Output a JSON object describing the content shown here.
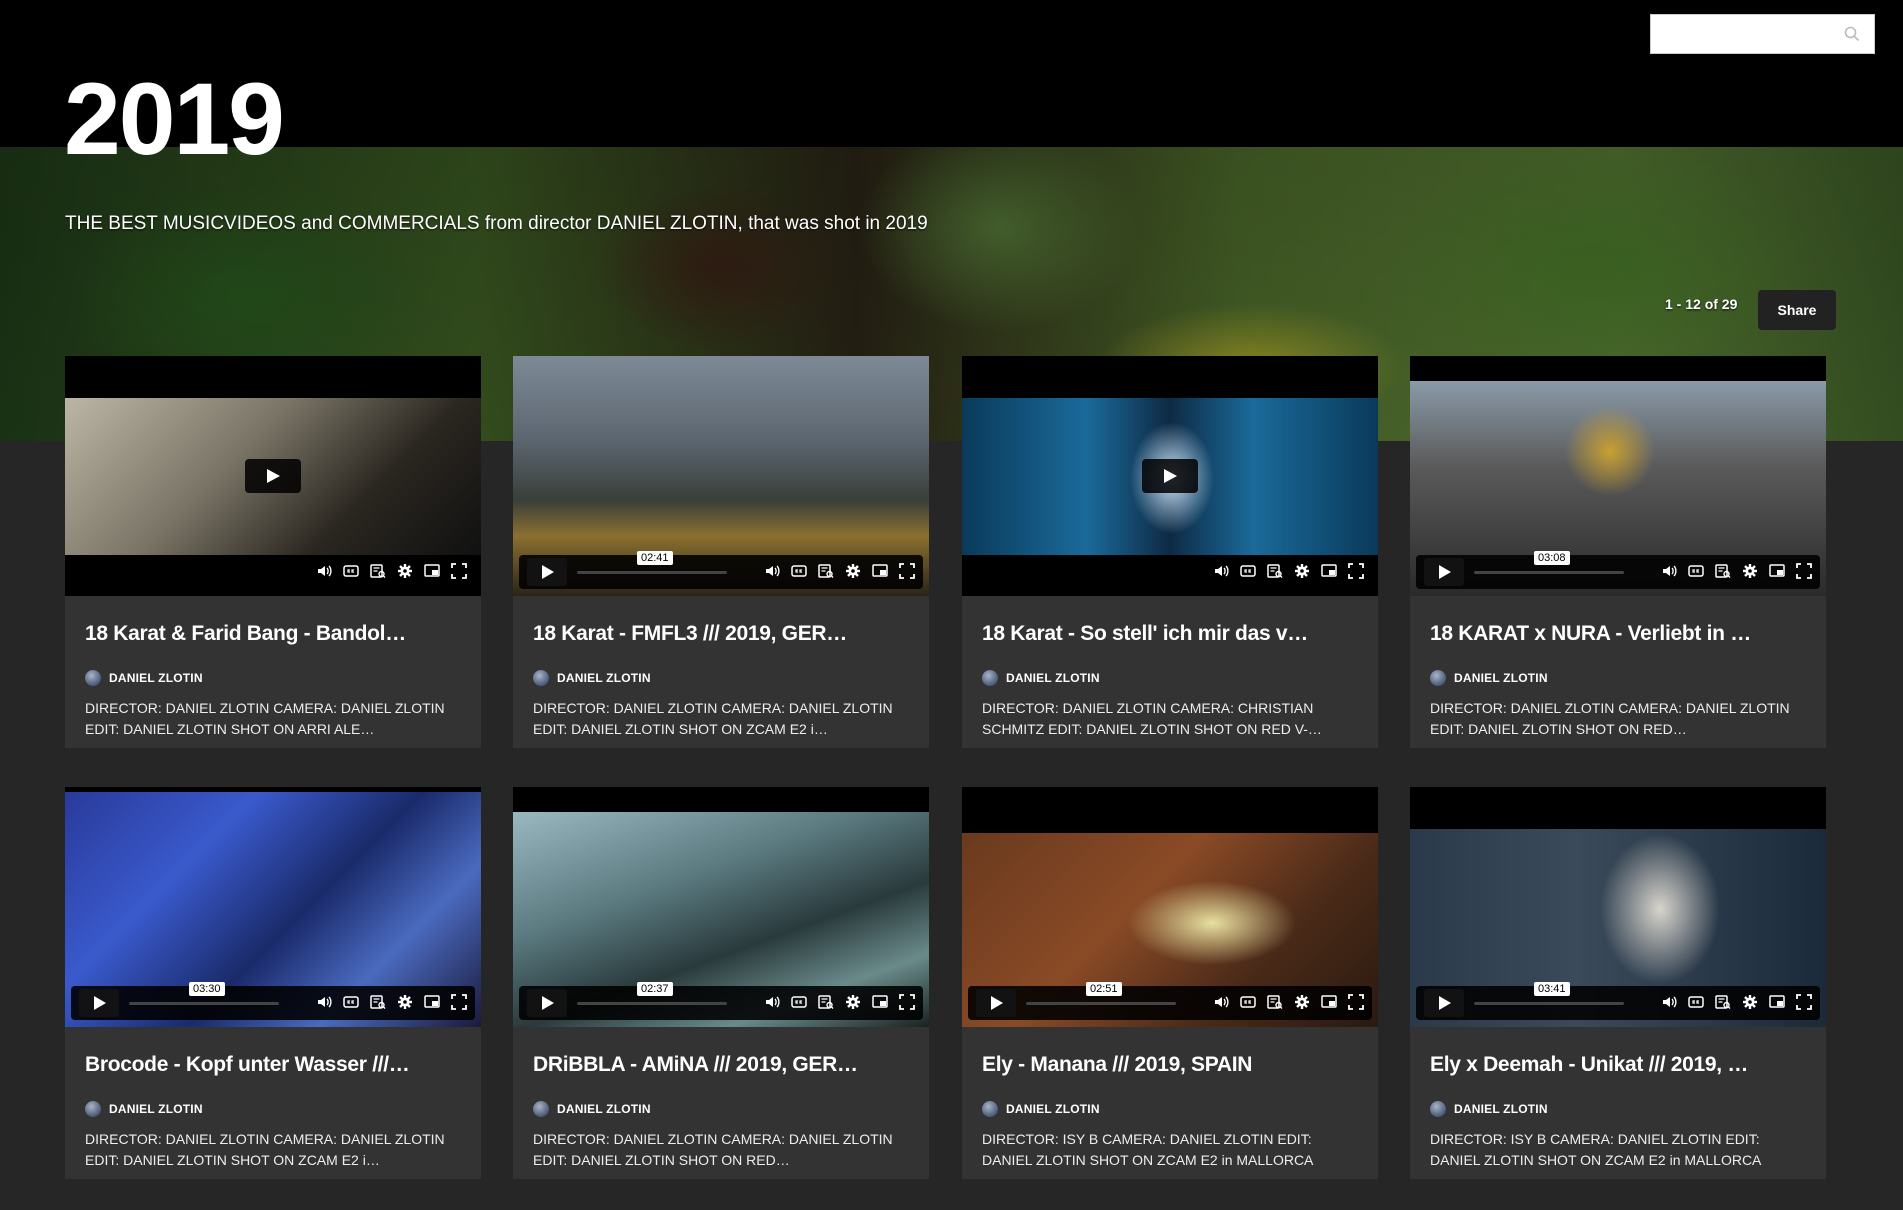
{
  "header": {
    "title": "2019",
    "description": "THE BEST MUSICVIDEOS and COMMERCIALS from director DANIEL ZLOTIN, that was shot in 2019",
    "count": "1 - 12 of 29",
    "share_label": "Share",
    "search": {
      "value": "",
      "placeholder": ""
    }
  },
  "videos": [
    {
      "title": "18 Karat & Farid Bang - Bandol…",
      "author": "DANIEL ZLOTIN",
      "description": "DIRECTOR: DANIEL ZLOTIN CAMERA: DANIEL ZLOTIN EDIT: DANIEL ZLOTIN SHOT ON ARRI ALE…",
      "time": ""
    },
    {
      "title": "18 Karat - FMFL3 /// 2019, GER…",
      "author": "DANIEL ZLOTIN",
      "description": "DIRECTOR: DANIEL ZLOTIN CAMERA: DANIEL ZLOTIN EDIT: DANIEL ZLOTIN SHOT ON ZCAM E2 i…",
      "time": "02:41"
    },
    {
      "title": "18 Karat - So stell' ich mir das v…",
      "author": "DANIEL ZLOTIN",
      "description": "DIRECTOR: DANIEL ZLOTIN CAMERA: CHRISTIAN SCHMITZ EDIT: DANIEL ZLOTIN SHOT ON RED V-…",
      "time": ""
    },
    {
      "title": "18 KARAT x NURA - Verliebt in …",
      "author": "DANIEL ZLOTIN",
      "description": "DIRECTOR: DANIEL ZLOTIN CAMERA: DANIEL ZLOTIN EDIT: DANIEL ZLOTIN SHOT ON RED…",
      "time": "03:08"
    },
    {
      "title": "Brocode - Kopf unter Wasser ///…",
      "author": "DANIEL ZLOTIN",
      "description": "DIRECTOR: DANIEL ZLOTIN CAMERA: DANIEL ZLOTIN EDIT: DANIEL ZLOTIN SHOT ON ZCAM E2 i…",
      "time": "03:30"
    },
    {
      "title": "DRiBBLA - AMiNA /// 2019, GER…",
      "author": "DANIEL ZLOTIN",
      "description": "DIRECTOR: DANIEL ZLOTIN CAMERA: DANIEL ZLOTIN EDIT: DANIEL ZLOTIN SHOT ON RED…",
      "time": "02:37"
    },
    {
      "title": "Ely - Manana /// 2019, SPAIN",
      "author": "DANIEL ZLOTIN",
      "description": "DIRECTOR: ISY B CAMERA: DANIEL ZLOTIN EDIT: DANIEL ZLOTIN SHOT ON ZCAM E2 in MALLORCA",
      "time": "02:51"
    },
    {
      "title": "Ely x Deemah - Unikat /// 2019, …",
      "author": "DANIEL ZLOTIN",
      "description": "DIRECTOR: ISY B CAMERA: DANIEL ZLOTIN EDIT: DANIEL ZLOTIN SHOT ON ZCAM E2 in MALLORCA",
      "time": "03:41"
    }
  ],
  "icons": [
    "search-icon",
    "play-icon",
    "volume-icon",
    "captions-icon",
    "transcript-icon",
    "settings-icon",
    "pip-icon",
    "fullscreen-icon"
  ],
  "colors": {
    "page_bg": "#262626",
    "card_bg": "#333333",
    "topbar_bg": "#000000"
  }
}
